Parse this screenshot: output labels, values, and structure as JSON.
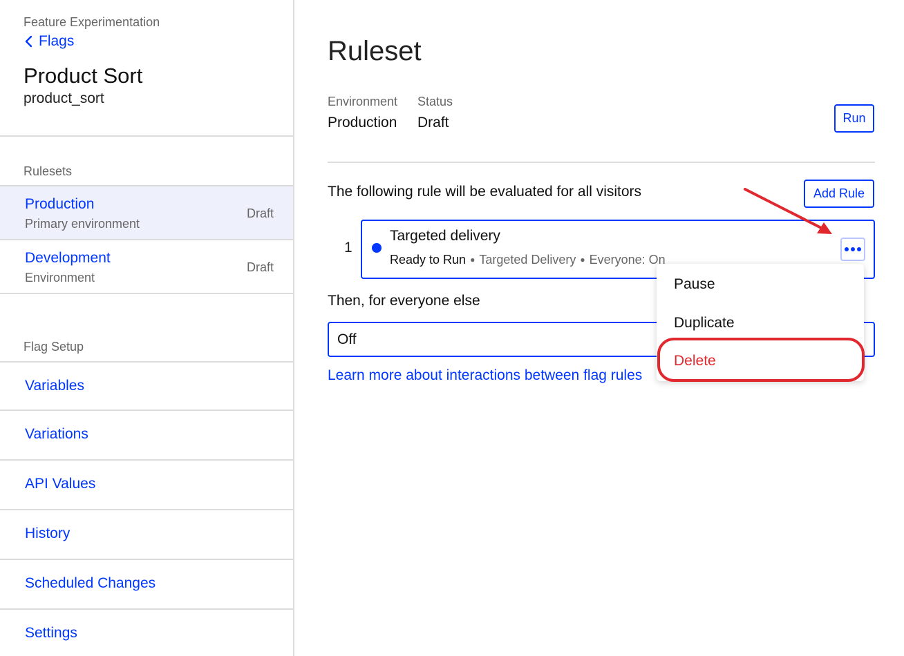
{
  "sidebar": {
    "eyebrow": "Feature Experimentation",
    "back_label": "Flags",
    "flag_name": "Product Sort",
    "flag_key": "product_sort",
    "rulesets_label": "Rulesets",
    "rulesets": [
      {
        "name": "Production",
        "description": "Primary environment",
        "status": "Draft",
        "active": true
      },
      {
        "name": "Development",
        "description": "Environment",
        "status": "Draft",
        "active": false
      }
    ],
    "flag_setup_label": "Flag Setup",
    "setup_items": [
      {
        "label": "Variables"
      },
      {
        "label": "Variations"
      },
      {
        "label": "API Values"
      },
      {
        "label": "History"
      },
      {
        "label": "Scheduled Changes"
      },
      {
        "label": "Settings"
      }
    ]
  },
  "main": {
    "title": "Ruleset",
    "environment_label": "Environment",
    "environment_value": "Production",
    "status_label": "Status",
    "status_value": "Draft",
    "run_button": "Run",
    "rule_intro": "The following rule will be evaluated for all visitors",
    "add_rule_button": "Add Rule",
    "rule": {
      "index": "1",
      "name": "Targeted delivery",
      "state": "Ready to Run",
      "type": "Targeted Delivery",
      "audience": "Everyone: On"
    },
    "else_label": "Then, for everyone else",
    "else_value": "Off",
    "learn_more": "Learn more about interactions between flag rules"
  },
  "menu": {
    "items": [
      {
        "label": "Pause"
      },
      {
        "label": "Duplicate"
      },
      {
        "label": "Delete"
      }
    ]
  },
  "colors": {
    "accent": "#0037ff",
    "danger": "#e0282e",
    "active_bg": "#eef1fb",
    "border": "#dcdcdc",
    "muted_text": "#666666"
  }
}
